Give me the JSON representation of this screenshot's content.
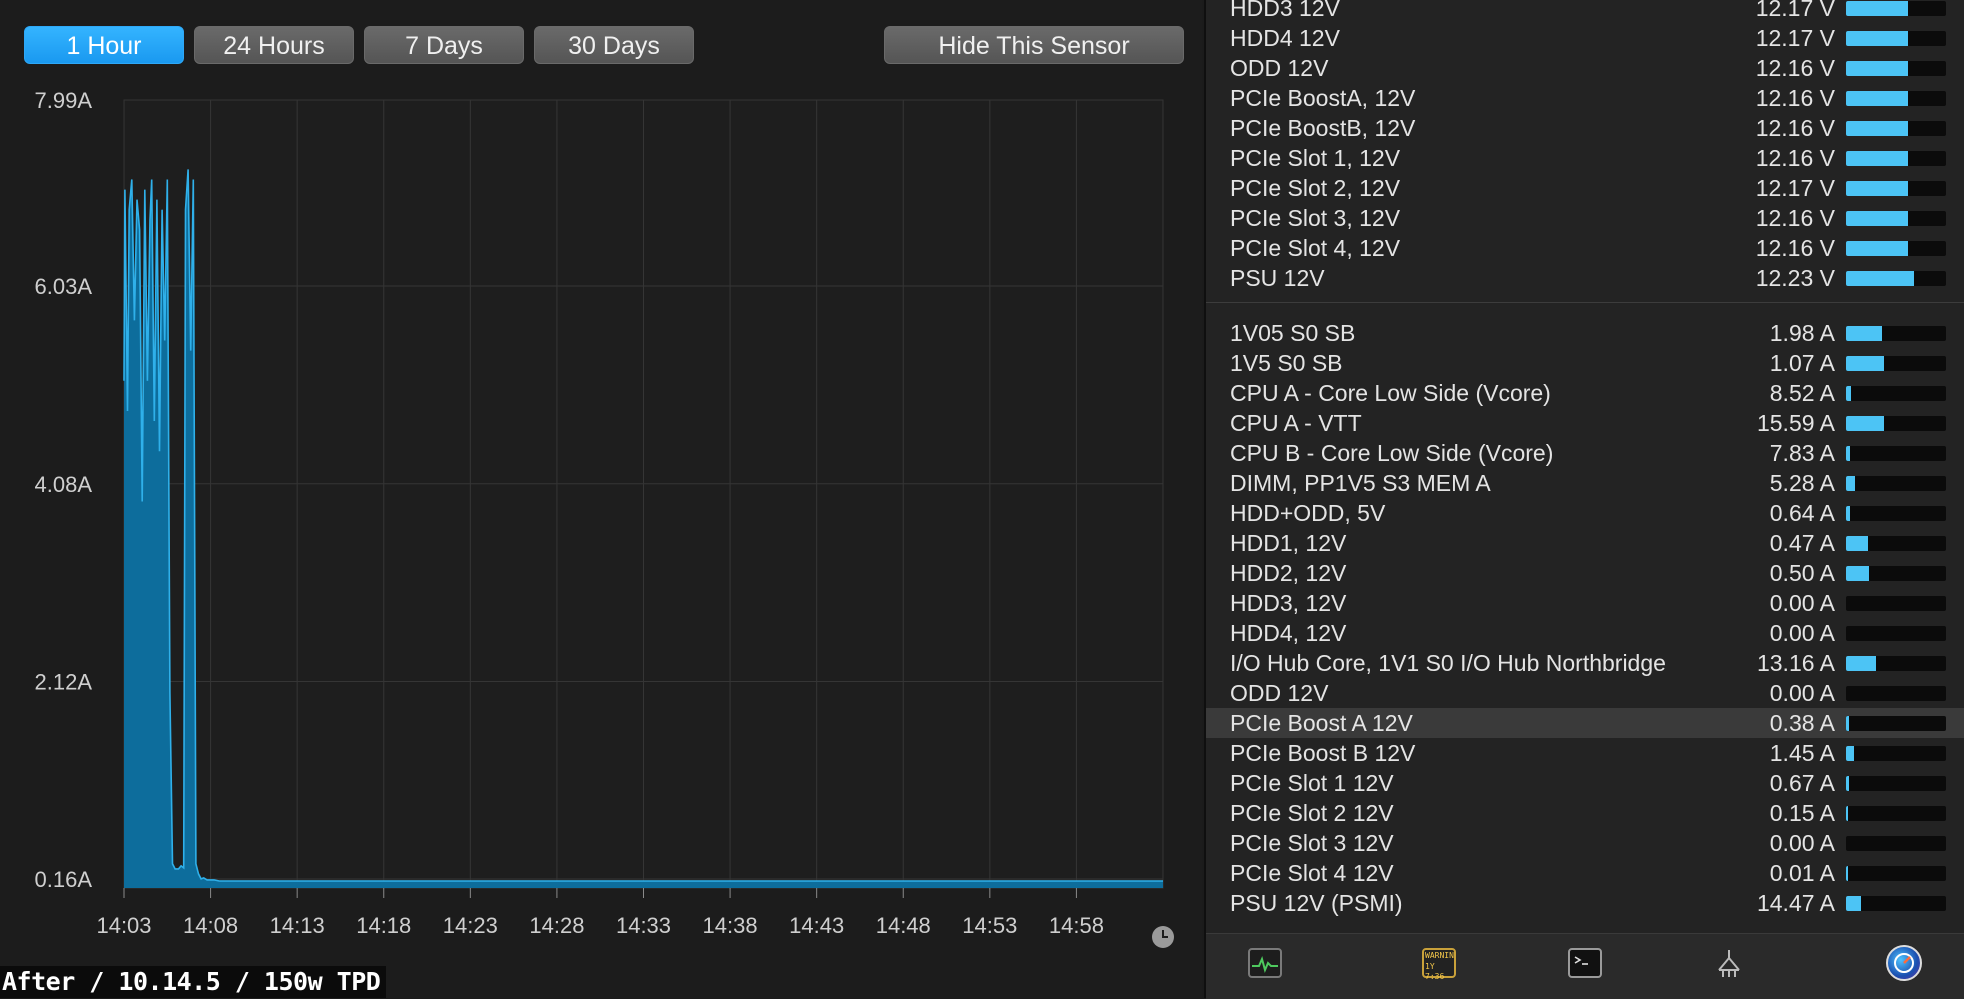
{
  "toolbar": {
    "ranges": [
      "1 Hour",
      "24 Hours",
      "7 Days",
      "30 Days"
    ],
    "active_range": "1 Hour",
    "hide_label": "Hide This Sensor"
  },
  "caption": "After / 10.14.5 / 150w TPD",
  "chart_data": {
    "type": "area",
    "x_tick_labels": [
      "14:03",
      "14:08",
      "14:13",
      "14:18",
      "14:23",
      "14:28",
      "14:33",
      "14:38",
      "14:43",
      "14:48",
      "14:53",
      "14:58"
    ],
    "y_tick_labels": [
      "7.99A",
      "6.03A",
      "4.08A",
      "2.12A",
      "0.16A"
    ],
    "ylim": [
      0.16,
      7.99
    ],
    "xlim_minutes": [
      0,
      60
    ],
    "grid": true,
    "colors": {
      "fill": "#0d6d9c",
      "line": "#2fb0ea"
    },
    "x": [
      0,
      0.05,
      0.2,
      0.3,
      0.45,
      0.6,
      0.75,
      0.9,
      1.05,
      1.2,
      1.35,
      1.5,
      1.6,
      1.75,
      1.9,
      2.05,
      2.2,
      2.35,
      2.5,
      2.65,
      2.8,
      2.95,
      3.05,
      3.15,
      3.3,
      3.45,
      3.55,
      3.7,
      3.85,
      4.0,
      4.15,
      4.3,
      4.45,
      4.6,
      4.7,
      4.8,
      4.9,
      5.2,
      5.5,
      5.7,
      5.8,
      5.9,
      6.0,
      6.1,
      6.2,
      6.3,
      6.45,
      6.6,
      6.8,
      7.0,
      7.2,
      8.0,
      9.0,
      9.5,
      10.0,
      10.5,
      11.0,
      11.3,
      11.5,
      12.0,
      12.5,
      13.0,
      13.3,
      13.5,
      13.7,
      13.9,
      14.0,
      14.2,
      14.5,
      15.0,
      20.0,
      25.0,
      30.0,
      35.0,
      36.5,
      36.8,
      37.0,
      37.3,
      40.0,
      40.2,
      40.4,
      40.6,
      40.8,
      41.0,
      41.3,
      41.6,
      42.0,
      42.2,
      42.6,
      42.9,
      43.1,
      43.3,
      43.6,
      44.0,
      44.5,
      45.0,
      45.5,
      46.0,
      46.5,
      47.0,
      47.5,
      48.0,
      48.5,
      49.0,
      49.5,
      50.0,
      50.5,
      51.0,
      51.5,
      52.0,
      52.5,
      53.0,
      53.5,
      54.0,
      54.5,
      55.0,
      55.5,
      56.0,
      56.5,
      57.0,
      57.5,
      58.0,
      58.5,
      58.9,
      59.0,
      59.1,
      59.2,
      59.5,
      60.0
    ],
    "values": [
      5.2,
      7.1,
      4.9,
      6.9,
      7.2,
      5.8,
      7.0,
      6.7,
      4.0,
      7.1,
      5.2,
      6.8,
      7.2,
      4.8,
      7.0,
      4.5,
      6.9,
      5.6,
      7.2,
      2.1,
      0.4,
      0.35,
      0.35,
      0.35,
      0.38,
      0.36,
      6.9,
      7.3,
      5.5,
      7.2,
      0.4,
      0.3,
      0.25,
      0.26,
      0.25,
      0.24,
      0.24,
      0.24,
      0.23,
      0.23,
      0.23,
      0.23,
      0.23,
      0.23,
      0.23,
      0.23,
      0.23,
      0.23,
      0.23,
      0.23,
      0.23,
      0.23,
      0.23,
      0.23,
      0.23,
      0.23,
      0.23,
      0.23,
      0.23,
      0.23,
      0.23,
      0.23,
      0.23,
      0.23,
      0.23,
      0.23,
      0.23,
      0.23,
      0.23,
      0.23,
      0.23,
      0.23,
      0.23,
      0.23,
      0.23,
      0.23,
      0.23,
      0.23,
      0.23,
      0.23,
      0.23,
      0.23,
      0.23,
      0.23,
      0.23,
      0.23,
      0.23,
      0.23,
      0.23,
      0.23,
      0.23,
      0.23,
      0.23,
      0.23,
      0.23,
      0.23,
      0.23,
      0.23,
      0.23,
      0.23,
      0.23,
      0.23,
      0.23,
      0.23,
      0.23,
      0.23,
      0.23,
      0.23,
      0.23,
      0.23,
      0.23,
      0.23,
      0.23,
      0.23,
      0.23,
      0.23,
      0.23,
      0.23,
      0.23,
      0.23,
      0.23,
      0.23,
      0.23,
      0.23,
      0.23,
      0.23,
      0.23,
      0.23,
      0.23,
      0.23,
      0.23,
      0.23,
      0.23,
      0.23,
      0.23,
      0.23,
      0.23,
      0.23,
      0.23
    ]
  },
  "voltage_rows": [
    {
      "name": "HDD3 12V",
      "value": "12.17 V",
      "level": 0.62
    },
    {
      "name": "HDD4 12V",
      "value": "12.17 V",
      "level": 0.62
    },
    {
      "name": "ODD 12V",
      "value": "12.16 V",
      "level": 0.62
    },
    {
      "name": "PCIe BoostA, 12V",
      "value": "12.16 V",
      "level": 0.62
    },
    {
      "name": "PCIe BoostB, 12V",
      "value": "12.16 V",
      "level": 0.62
    },
    {
      "name": "PCIe Slot 1, 12V",
      "value": "12.16 V",
      "level": 0.62
    },
    {
      "name": "PCIe Slot 2, 12V",
      "value": "12.17 V",
      "level": 0.62
    },
    {
      "name": "PCIe Slot 3, 12V",
      "value": "12.16 V",
      "level": 0.62
    },
    {
      "name": "PCIe Slot 4, 12V",
      "value": "12.16 V",
      "level": 0.62
    },
    {
      "name": "PSU 12V",
      "value": "12.23 V",
      "level": 0.68
    }
  ],
  "current_rows": [
    {
      "name": "1V05 S0 SB",
      "value": "1.98 A",
      "level": 0.36
    },
    {
      "name": "1V5 S0 SB",
      "value": "1.07 A",
      "level": 0.38
    },
    {
      "name": "CPU A - Core Low Side (Vcore)",
      "value": "8.52 A",
      "level": 0.05
    },
    {
      "name": "CPU A - VTT",
      "value": "15.59 A",
      "level": 0.38
    },
    {
      "name": "CPU B - Core Low Side (Vcore)",
      "value": "7.83 A",
      "level": 0.04
    },
    {
      "name": "DIMM, PP1V5 S3 MEM A",
      "value": "5.28 A",
      "level": 0.09
    },
    {
      "name": "HDD+ODD, 5V",
      "value": "0.64 A",
      "level": 0.04
    },
    {
      "name": "HDD1, 12V",
      "value": "0.47 A",
      "level": 0.22
    },
    {
      "name": "HDD2, 12V",
      "value": "0.50 A",
      "level": 0.23
    },
    {
      "name": "HDD3, 12V",
      "value": "0.00 A",
      "level": 0.0
    },
    {
      "name": "HDD4, 12V",
      "value": "0.00 A",
      "level": 0.0
    },
    {
      "name": "I/O Hub Core, 1V1 S0 I/O Hub Northbridge",
      "value": "13.16 A",
      "level": 0.3
    },
    {
      "name": "ODD 12V",
      "value": "0.00 A",
      "level": 0.0
    },
    {
      "name": "PCIe Boost A 12V",
      "value": "0.38 A",
      "level": 0.03
    },
    {
      "name": "PCIe Boost B 12V",
      "value": "1.45 A",
      "level": 0.08
    },
    {
      "name": "PCIe Slot 1 12V",
      "value": "0.67 A",
      "level": 0.03
    },
    {
      "name": "PCIe Slot 2 12V",
      "value": "0.15 A",
      "level": 0.02
    },
    {
      "name": "PCIe Slot 3 12V",
      "value": "0.00 A",
      "level": 0.0
    },
    {
      "name": "PCIe Slot 4 12V",
      "value": "0.01 A",
      "level": 0.02
    },
    {
      "name": "PSU 12V (PSMI)",
      "value": "14.47 A",
      "level": 0.15
    }
  ],
  "highlighted_row": "PCIe Boost A 12V",
  "dock": {
    "items": [
      "activity-monitor-icon",
      "console-icon",
      "terminal-icon",
      "network-utility-icon",
      "istat-menus-icon"
    ],
    "console_badge_text": "WARNIN",
    "console_badge_time": "1Y 7:36"
  }
}
